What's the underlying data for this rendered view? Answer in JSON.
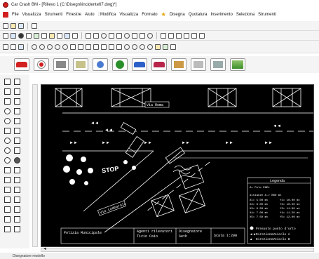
{
  "window": {
    "title": "Car Crash BM - [Rilievo 1 (C:\\Disegni\\incidente67.dwg)*]"
  },
  "menu": {
    "items": [
      "File",
      "Visualizza",
      "Strumenti",
      "Finestre",
      "Aiuto",
      "::Modifica",
      "Visualizza",
      "Formato",
      "Disegna",
      "Quotatura",
      "Inserimento",
      "Seleziona",
      "Strumenti"
    ]
  },
  "drawing": {
    "street_top": "Via Roma",
    "street_bottom": "Via Lombardia",
    "stop_text": "STOP",
    "title_block": {
      "col1": "Polizia Municipale",
      "col2_line1": "Agenti rilevatori",
      "col2_line2": "Tizio   Caio",
      "col3_line1": "Disegnatore",
      "col3_line2": "Seth",
      "col4": "Scala 1:200"
    },
    "legend": {
      "title": "Legenda",
      "header": "A= Polo ENEL",
      "subheader": "distanze  A->  B00 mt",
      "rows": [
        [
          "X1= 5.00 mt",
          "Y1= 10.00 mt"
        ],
        [
          "X2= 6.00 mt",
          "Y2= 10.50 mt"
        ],
        [
          "X3= 6.50 mt",
          "Y3= 11.00 mt"
        ],
        [
          "X4= 7.00 mt",
          "Y4= 11.50 mt"
        ],
        [
          "X5= 7.50 mt",
          "Y5= 12.00 mt"
        ]
      ],
      "items": [
        "Presunto punto d'urto",
        "DirezioneVeicolo A",
        "DirezioneVeicolo B"
      ]
    }
  },
  "status": {
    "text": "Disegnatore modello"
  },
  "icons": {
    "app": "car-crash-app-icon",
    "draw": "star-icon"
  },
  "colors": {
    "canvas_bg": "#000000",
    "line": "#ffffff",
    "accent": "#d21f1f"
  }
}
